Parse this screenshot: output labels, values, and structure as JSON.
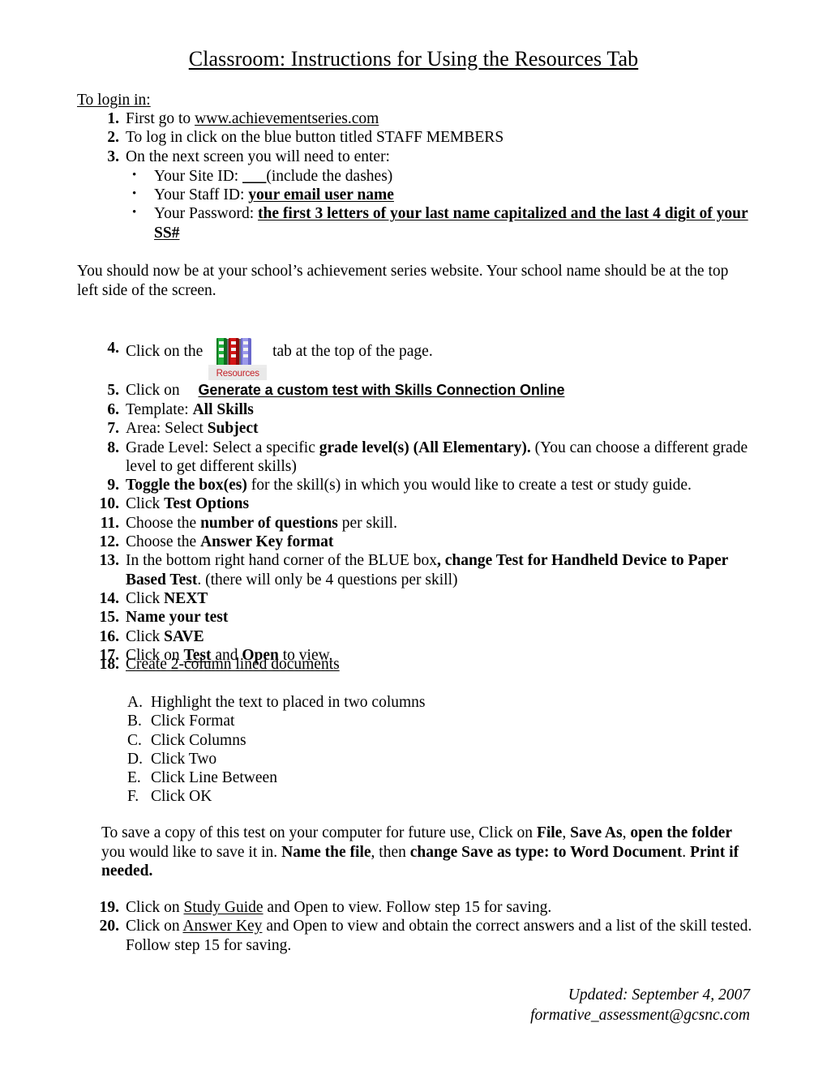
{
  "document": {
    "title": "Classroom:  Instructions for Using the Resources Tab",
    "login_heading": "To login in:",
    "steps_1_3": [
      {
        "num": "1.",
        "pre": "First go to ",
        "link": "www.achievementseries.com",
        "post": ""
      },
      {
        "num": "2.",
        "pre": "To log in click on the blue button titled STAFF MEMBERS",
        "link": "",
        "post": ""
      },
      {
        "num": "3.",
        "pre": "On the next screen you will need to enter:",
        "link": "",
        "post": ""
      }
    ],
    "bullets": [
      {
        "label": "Your Site ID:  ",
        "value": "___",
        "after": "(include the dashes)"
      },
      {
        "label": "Your Staff ID: ",
        "value": " your email user name  ",
        "after": ""
      },
      {
        "label": "Your Password: ",
        "value": "the first 3 letters of your last name capitalized and the last 4 digit of your SS#",
        "after": ""
      }
    ],
    "paragraph_after_login": "You should now be at your school’s achievement series website.  Your school name should be at the top left side of the screen.",
    "step4": {
      "num": "4.",
      "pre": "Click on the ",
      "icon_label": "Resources",
      "post": " tab at the top of the page."
    },
    "step5": {
      "num": "5.",
      "pre": "Click on ",
      "emphasis": "Generate a custom test with Skills Connection Online"
    },
    "step6": {
      "num": "6.",
      "pre": "Template: ",
      "bold": "All Skills"
    },
    "step7": {
      "num": "7.",
      "pre": "Area:  Select ",
      "bold": "Subject"
    },
    "step8": {
      "num": "8.",
      "pre": "Grade Level: Select a specific ",
      "bold": "grade level(s) (All Elementary).",
      "post": "  (You can choose a different grade level to get different skills)"
    },
    "step9": {
      "num": "9.",
      "bold": "Toggle the box(es)",
      "post": " for the skill(s) in which you would like to create a test or study guide."
    },
    "step10": {
      "num": "10.",
      "pre": "Click ",
      "bold": "Test Options"
    },
    "step11": {
      "num": "11.",
      "pre": "Choose the ",
      "bold": "number of questions",
      "post": " per skill."
    },
    "step12": {
      "num": "12.",
      "pre": "Choose the ",
      "bold": "Answer Key format"
    },
    "step13": {
      "num": "13.",
      "pre": "In the bottom right hand corner of the BLUE box",
      "bold": ", change Test for Handheld Device to Paper Based Test",
      "post": ".  (there will only be 4 questions per skill)"
    },
    "step14": {
      "num": "14.",
      "pre": "Click ",
      "bold": "NEXT"
    },
    "step15": {
      "num": "15.",
      "bold": "Name your test"
    },
    "step16": {
      "num": "16.",
      "pre": "Click ",
      "bold": "SAVE"
    },
    "step17": {
      "num": "17.",
      "pre": "Click on ",
      "bold_underline": "Test",
      "mid": " and ",
      "bold2": "Open",
      "post": " to view."
    },
    "step18": {
      "num": "18.",
      "underline": "Create 2-column lined documents"
    },
    "sub_steps": [
      {
        "letter": "A.",
        "text": "Highlight the text to placed in two columns"
      },
      {
        "letter": "B.",
        "text": "Click Format"
      },
      {
        "letter": "C.",
        "text": "Click Columns"
      },
      {
        "letter": "D.",
        "text": "Click Two"
      },
      {
        "letter": "E.",
        "text": "Click Line Between"
      },
      {
        "letter": "F.",
        "text": "Click OK"
      }
    ],
    "save_paragraph": {
      "p1": "To save a copy of this test on your computer for future use, Click on ",
      "b1": "File",
      "p2": ", ",
      "b2": "Save As",
      "p3": ", ",
      "b3": "open the folder",
      "p4": " you would like to save it in. ",
      "b4": "Name the file",
      "p5": ", then ",
      "b5": "change Save as type: to Word Document",
      "p6": ". ",
      "b6": "Print if needed."
    },
    "step19": {
      "num": "19.",
      "pre": "Click on ",
      "underline": "Study Guide",
      "post": " and Open to view. Follow step 15 for saving."
    },
    "step20": {
      "num": "20.",
      "pre": "Click on ",
      "underline": "Answer Key",
      "post": " and Open to view and obtain the correct answers and a list of the skill tested.  Follow step 15 for saving."
    },
    "footer": {
      "updated": "Updated:  September 4, 2007",
      "email": "formative_assessment@gcsnc.com"
    },
    "colors": {
      "book_green": "#1a9e32",
      "book_red": "#cc1111",
      "book_blue": "#8e8ce0",
      "resources_text": "#c42026",
      "tab_background": "#e9e9e9"
    }
  }
}
